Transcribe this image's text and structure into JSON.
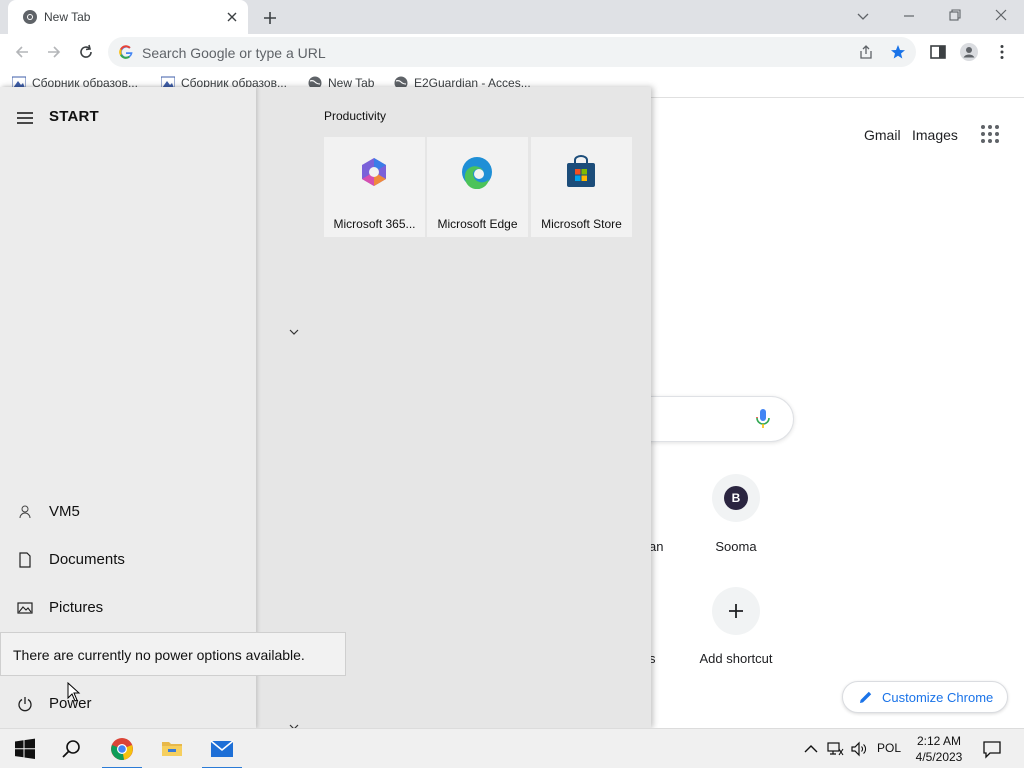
{
  "browser": {
    "tab": {
      "title": "New Tab"
    },
    "omnibox": {
      "placeholder": "Search Google or type a URL"
    },
    "bookmarks": [
      {
        "label": "Сборник образов...",
        "icon": "image-bookmark-icon"
      },
      {
        "label": "Сборник образов...",
        "icon": "image-bookmark-icon"
      },
      {
        "label": "New Tab",
        "icon": "globe-icon"
      },
      {
        "label": "E2Guardian - Acces...",
        "icon": "globe-icon"
      }
    ]
  },
  "ntp": {
    "links": {
      "gmail": "Gmail",
      "images": "Images"
    },
    "shortcuts": [
      {
        "label": "Sooma",
        "initial": "B"
      },
      {
        "label": "Add shortcut",
        "initial": "+"
      }
    ],
    "partial_labels": [
      "an",
      "s"
    ],
    "customize_label": "Customize Chrome",
    "accent_color": "#1a73e8"
  },
  "start_menu": {
    "title": "START",
    "user": "VM5",
    "items": [
      {
        "label": "Documents",
        "icon": "document-icon"
      },
      {
        "label": "Pictures",
        "icon": "pictures-icon"
      },
      {
        "label": "Power",
        "icon": "power-icon"
      }
    ],
    "group": "Productivity",
    "tiles": [
      {
        "label": "Microsoft 365...",
        "icon": "microsoft-365-icon"
      },
      {
        "label": "Microsoft Edge",
        "icon": "edge-icon"
      },
      {
        "label": "Microsoft Store",
        "icon": "store-icon"
      }
    ],
    "tooltip": "There are currently no power options available."
  },
  "taskbar": {
    "language": "POL",
    "time": "2:12 AM",
    "date": "4/5/2023"
  }
}
